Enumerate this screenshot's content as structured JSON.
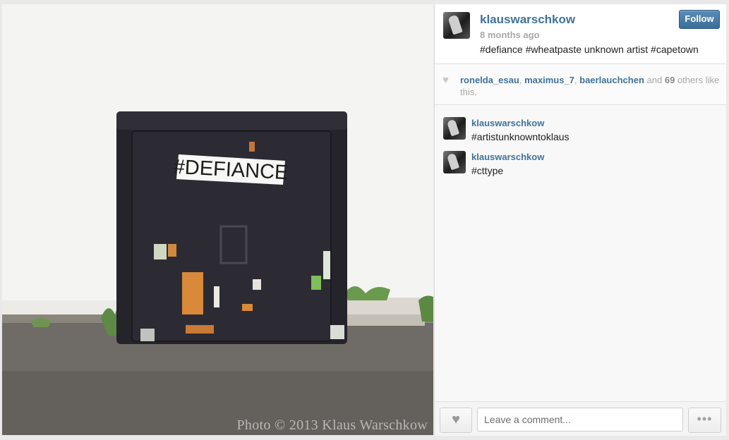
{
  "post": {
    "username": "klauswarschkow",
    "time_ago": "8 months ago",
    "caption": "#defiance #wheatpaste unknown artist #capetown",
    "follow_label": "Follow",
    "photo_sign_text": "#DEFIANCE",
    "watermark": "Photo © 2013 Klaus Warschkow"
  },
  "likes": {
    "users": [
      "ronelda_esau",
      "maximus_7",
      "baerlauchchen"
    ],
    "sep": ", ",
    "and_word": "and",
    "others_count": "69",
    "others_suffix": "others like this."
  },
  "comments": [
    {
      "username": "klauswarschkow",
      "text": "#artistunknowntoklaus"
    },
    {
      "username": "klauswarschkow",
      "text": "#cttype"
    }
  ],
  "footer": {
    "comment_placeholder": "Leave a comment...",
    "more_label": "•••"
  },
  "icons": {
    "like": "heart-icon",
    "more": "ellipsis-icon"
  },
  "colors": {
    "username_blue": "#3f729b",
    "follow_button": "#3b6e98"
  }
}
